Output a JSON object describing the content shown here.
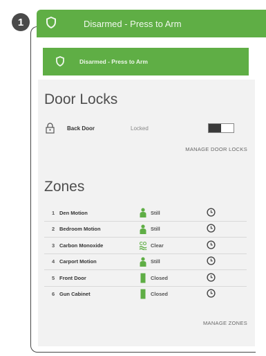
{
  "step": "1",
  "top_banner": {
    "label": "Disarmed - Press to Arm"
  },
  "inner_banner": {
    "label": "Disarmed - Press to Arm"
  },
  "door_locks": {
    "title": "Door Locks",
    "items": [
      {
        "name": "Back Door",
        "status": "Locked"
      }
    ],
    "manage_label": "MANAGE DOOR LOCKS"
  },
  "zones": {
    "title": "Zones",
    "items": [
      {
        "num": "1",
        "name": "Den Motion",
        "status": "Still",
        "icon": "person-icon"
      },
      {
        "num": "2",
        "name": "Bedroom Motion",
        "status": "Still",
        "icon": "person-icon"
      },
      {
        "num": "3",
        "name": "Carbon Monoxide",
        "status": "Clear",
        "icon": "co-icon"
      },
      {
        "num": "4",
        "name": "Carport Motion",
        "status": "Still",
        "icon": "person-icon"
      },
      {
        "num": "5",
        "name": "Front Door",
        "status": "Closed",
        "icon": "door-icon"
      },
      {
        "num": "6",
        "name": "Gun Cabinet",
        "status": "Closed",
        "icon": "door-icon"
      }
    ],
    "manage_label": "MANAGE ZONES"
  },
  "colors": {
    "accent_green": "#5fae45",
    "panel_bg": "#f2f2f2"
  }
}
